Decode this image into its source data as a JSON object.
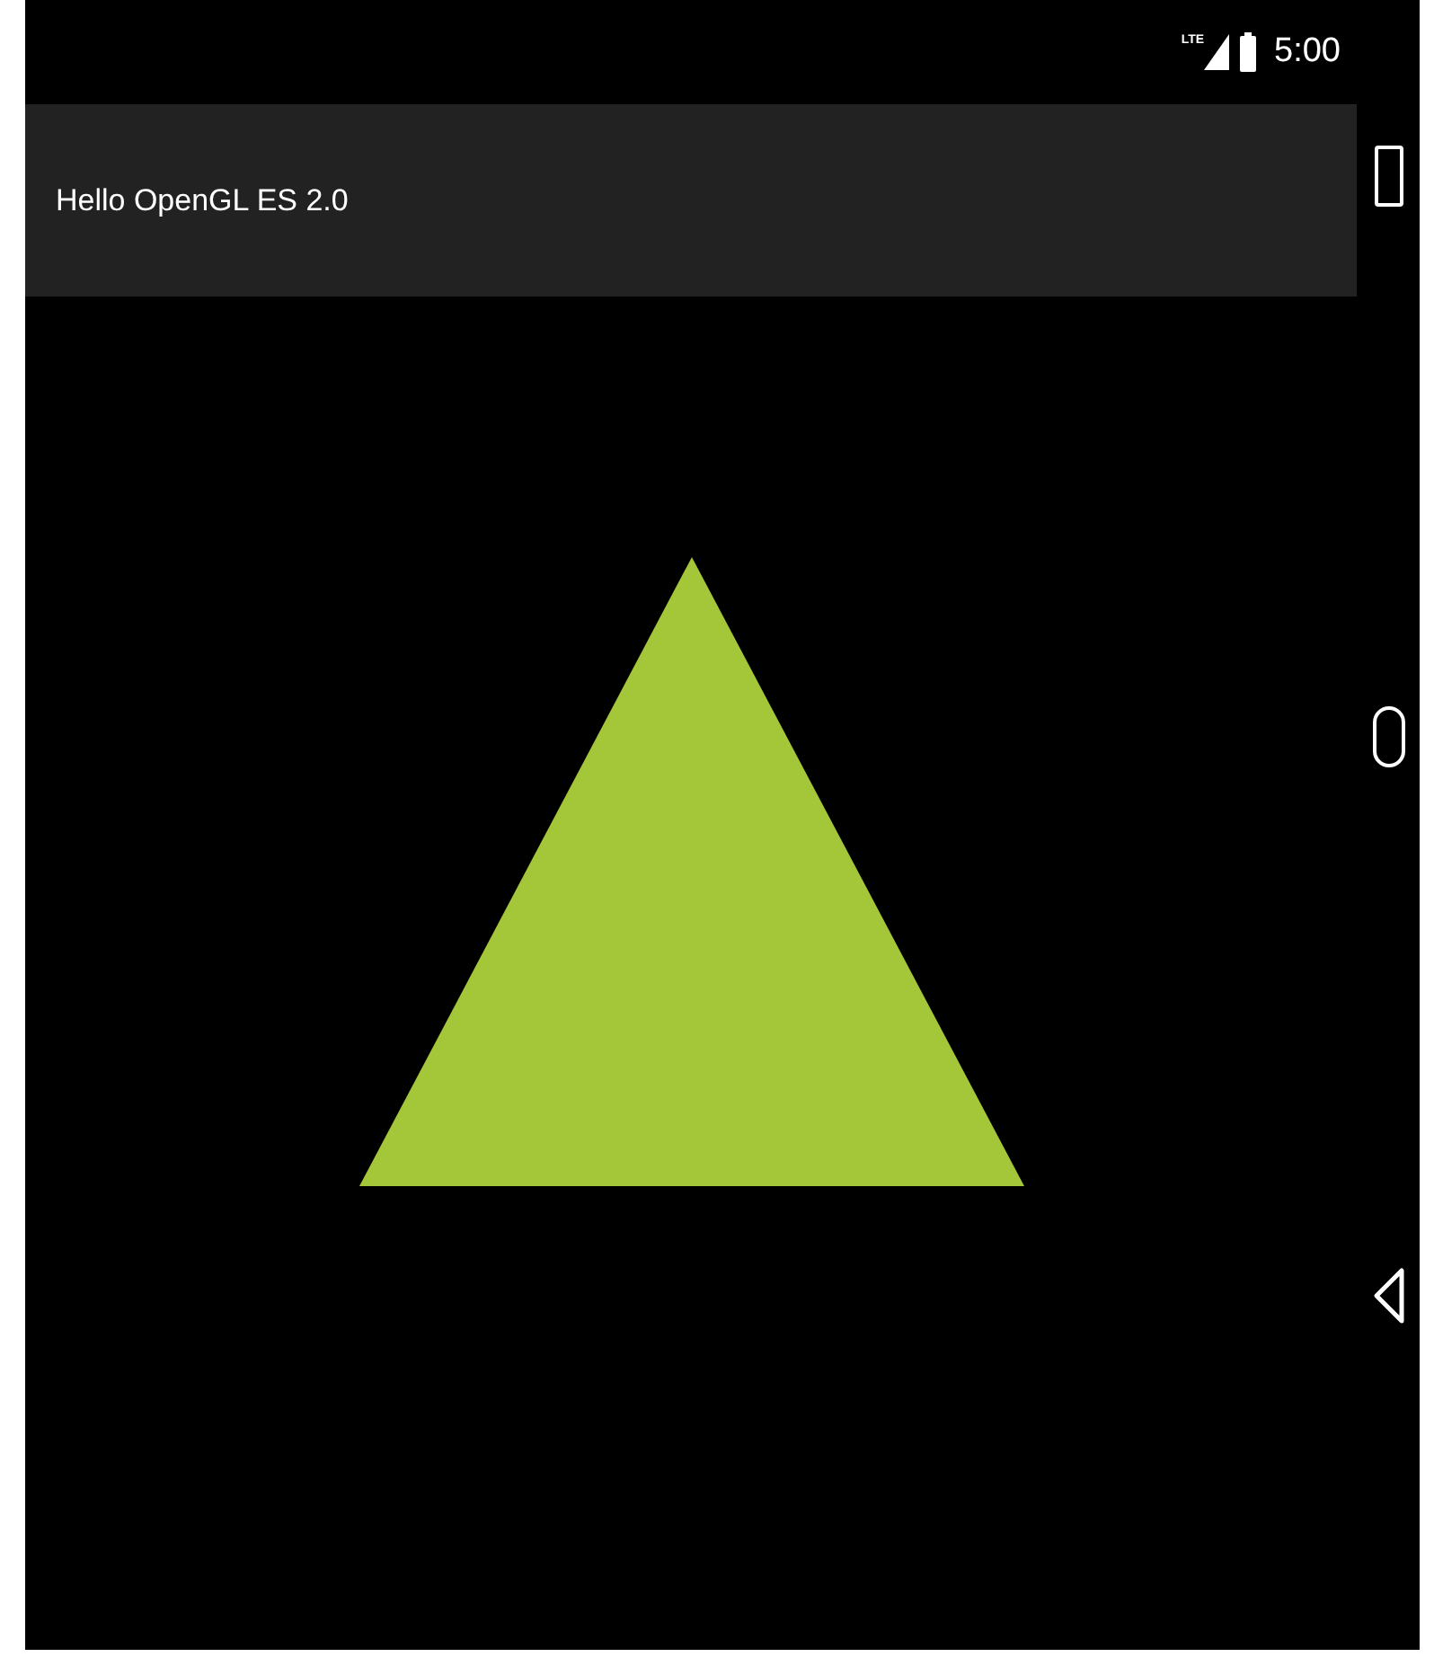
{
  "status_bar": {
    "network": "LTE",
    "time": "5:00"
  },
  "action_bar": {
    "title": "Hello OpenGL ES 2.0"
  }
}
